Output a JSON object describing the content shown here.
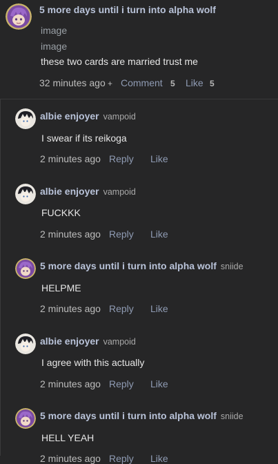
{
  "main_comment": {
    "author": "5 more days until i turn into alpha wolf",
    "images": [
      "image",
      "image"
    ],
    "body": "these two cards are married trust me",
    "time": "32 minutes ago",
    "plus": "+",
    "comment_label": "Comment",
    "comment_count": "5",
    "like_label": "Like",
    "like_count": "5"
  },
  "replies": [
    {
      "author": "albie enjoyer",
      "handle": "vampoid",
      "body": "I swear if its reikoga",
      "time": "2 minutes ago",
      "reply_label": "Reply",
      "like_label": "Like"
    },
    {
      "author": "albie enjoyer",
      "handle": "vampoid",
      "body": "FUCKKK",
      "time": "2 minutes ago",
      "reply_label": "Reply",
      "like_label": "Like"
    },
    {
      "author": "5 more days until i turn into alpha wolf",
      "handle": "sniide",
      "body": "HELPME",
      "time": "2 minutes ago",
      "reply_label": "Reply",
      "like_label": "Like"
    },
    {
      "author": "albie enjoyer",
      "handle": "vampoid",
      "body": "I agree with this actually",
      "time": "2 minutes ago",
      "reply_label": "Reply",
      "like_label": "Like"
    },
    {
      "author": "5 more days until i turn into alpha wolf",
      "handle": "sniide",
      "body": "HELL YEAH",
      "time": "2 minutes ago",
      "reply_label": "Reply",
      "like_label": "Like"
    }
  ],
  "colors": {
    "background": "#262627",
    "name": "#b9c3d9",
    "action": "#8f9bb3",
    "avatar_wolf": "#8e5fb5",
    "avatar_albie": "#e9e6e0"
  },
  "icons": [
    "wolf-avatar-icon",
    "albie-avatar-icon"
  ]
}
